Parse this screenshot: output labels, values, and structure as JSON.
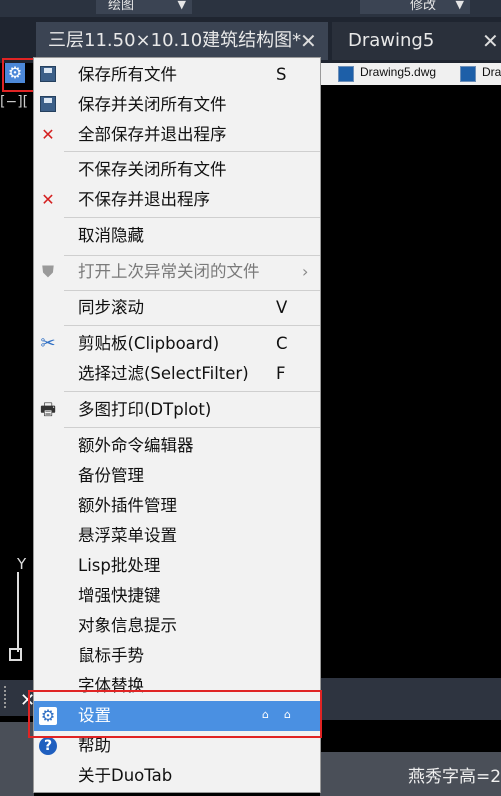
{
  "ribbon": {
    "left_label": "绘图",
    "right_label": "修改",
    "caret": "▼"
  },
  "tabs": [
    {
      "label": "三层11.50×10.10建筑结构图*",
      "close": "✕"
    },
    {
      "label": "Drawing5",
      "close": "✕"
    }
  ],
  "file_tabs": [
    {
      "name": "Drawing5.dwg",
      "icon": "dwg-file-icon"
    },
    {
      "name": "Dra",
      "icon": "dwg-file-icon"
    }
  ],
  "viewport_label": "[−][",
  "ucs_axis_label": "Y",
  "command_close": "✕",
  "status_text": "燕秀字高=2",
  "menu": {
    "items": [
      {
        "label": "保存所有文件",
        "shortcut": "S",
        "icon": "save-all-icon"
      },
      {
        "label": "保存并关闭所有文件",
        "shortcut": "",
        "icon": "save-close-icon"
      },
      {
        "label": "全部保存并退出程序",
        "shortcut": "",
        "icon": "red-x-icon"
      },
      {
        "label": "不保存关闭所有文件",
        "shortcut": "",
        "icon": ""
      },
      {
        "label": "不保存并退出程序",
        "shortcut": "",
        "icon": "red-x-icon"
      },
      {
        "label": "取消隐藏",
        "shortcut": "",
        "icon": ""
      },
      {
        "label": "打开上次异常关闭的文件",
        "shortcut": "",
        "icon": "shield-icon",
        "disabled": true,
        "submenu": "›"
      },
      {
        "label": "同步滚动",
        "shortcut": "V",
        "icon": ""
      },
      {
        "label": "剪贴板(Clipboard)",
        "shortcut": "C",
        "icon": "scissors-icon"
      },
      {
        "label": "选择过滤(SelectFilter)",
        "shortcut": "F",
        "icon": ""
      },
      {
        "label": "多图打印(DTplot)",
        "shortcut": "",
        "icon": "printer-icon"
      },
      {
        "label": "额外命令编辑器",
        "shortcut": "",
        "icon": ""
      },
      {
        "label": "备份管理",
        "shortcut": "",
        "icon": ""
      },
      {
        "label": "额外插件管理",
        "shortcut": "",
        "icon": ""
      },
      {
        "label": "悬浮菜单设置",
        "shortcut": "",
        "icon": ""
      },
      {
        "label": "Lisp批处理",
        "shortcut": "",
        "icon": ""
      },
      {
        "label": "增强快捷键",
        "shortcut": "",
        "icon": ""
      },
      {
        "label": "对象信息提示",
        "shortcut": "",
        "icon": ""
      },
      {
        "label": "鼠标手势",
        "shortcut": "",
        "icon": ""
      },
      {
        "label": "字体替换",
        "shortcut": "",
        "icon": ""
      },
      {
        "label": "设置",
        "shortcut": "",
        "icon": "gear-icon",
        "selected": true
      },
      {
        "label": "帮助",
        "shortcut": "",
        "icon": "help-icon"
      },
      {
        "label": "关于DuoTab",
        "shortcut": "",
        "icon": ""
      }
    ]
  },
  "colors": {
    "highlight": "#4a90e2",
    "annotation_red": "#e02424",
    "cad_background": "#000000"
  }
}
